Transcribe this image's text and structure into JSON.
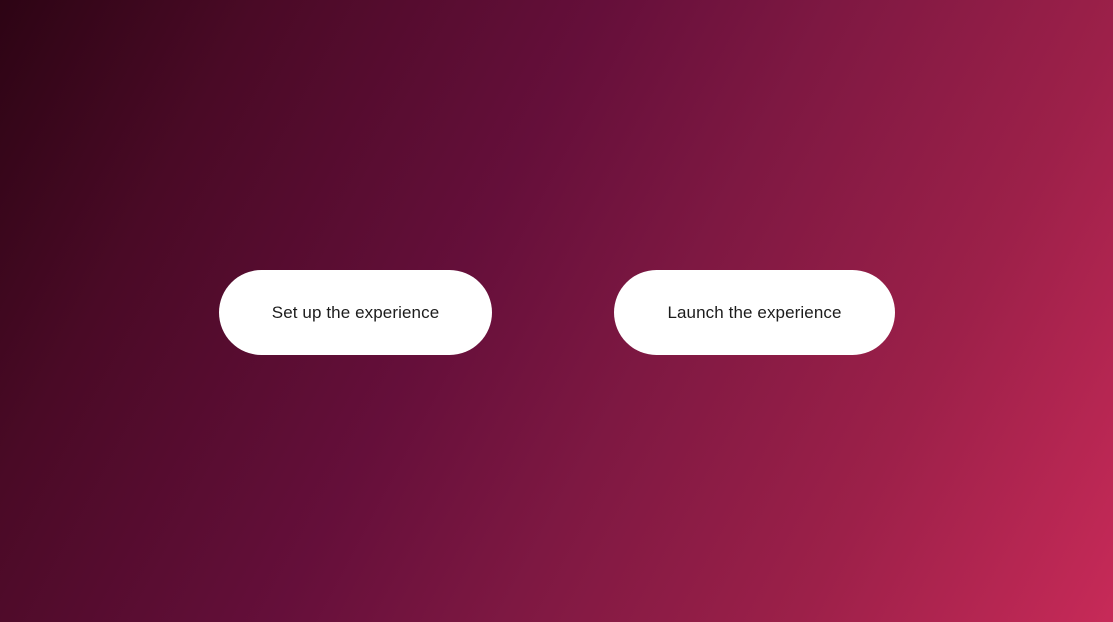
{
  "actions": {
    "setup_label": "Set up the experience",
    "launch_label": "Launch the experience"
  },
  "colors": {
    "background_start": "#2d0414",
    "background_mid": "#650f3a",
    "background_end": "#c72a58",
    "button_fill": "#ffffff",
    "button_text": "#1c1c1c"
  }
}
